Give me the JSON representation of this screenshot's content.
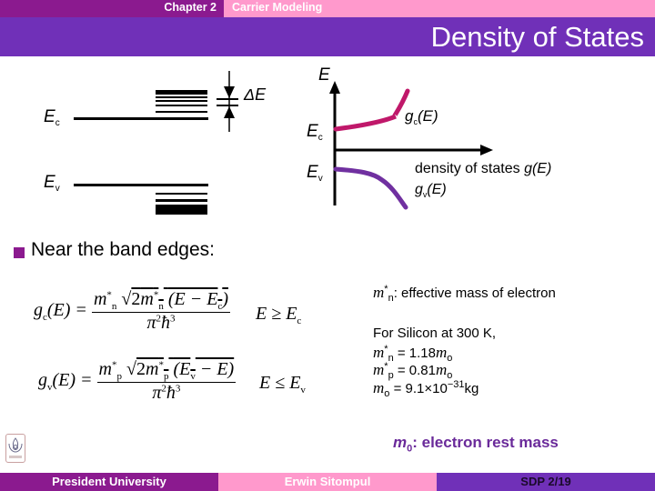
{
  "header": {
    "chapter": "Chapter 2",
    "subject": "Carrier Modeling",
    "title": "Density of States"
  },
  "band_diagram": {
    "ec_label": "E",
    "ec_sub": "c",
    "ev_label": "E",
    "ev_sub": "v",
    "delta_label": "ΔE"
  },
  "dos_plot": {
    "y_axis_label": "E",
    "ec_label": "E",
    "ec_sub": "c",
    "ev_label": "E",
    "ev_sub": "v",
    "x_axis_label": "density of states",
    "x_axis_func": "g(E)",
    "gc_label": "g",
    "gc_sub": "c",
    "gc_arg": "(E)",
    "gv_label": "g",
    "gv_sub": "v",
    "gv_arg": "(E)",
    "colors": {
      "gc": "#c0186a",
      "gv": "#7030a0"
    }
  },
  "bullet": {
    "text": "Near the band edges:"
  },
  "equations": {
    "gc": {
      "lhs": "g",
      "lhs_sub": "c",
      "arg": "(E) =",
      "num_pre": "m",
      "num_sub": "n",
      "sqrt": "2m",
      "sqrt_sub": "n",
      "paren": "(E − E",
      "paren_sub": "c",
      "close": ")",
      "den": "π",
      "den_sup": "2",
      "hbar": "ħ",
      "hbar_sup": "3",
      "cond": "E ≥ E",
      "cond_sub": "c"
    },
    "gv": {
      "lhs": "g",
      "lhs_sub": "v",
      "arg": "(E) =",
      "num_pre": "m",
      "num_sub": "p",
      "sqrt": "2m",
      "sqrt_sub": "p",
      "paren": "(E",
      "paren_sub": "v",
      "close": " − E)",
      "den": "π",
      "den_sup": "2",
      "hbar": "ħ",
      "hbar_sup": "3",
      "cond": "E ≤ E",
      "cond_sub": "v"
    }
  },
  "notes": {
    "mn_def": ":  effective mass of electron",
    "silicon": "For Silicon at 300 K,",
    "mn_value": "= 1.18",
    "mp_value": "= 0.81",
    "m0_value": "= 9.1×10",
    "m0_exp": "−31",
    "m0_unit": "kg",
    "m_sym": "m",
    "star": "*",
    "n_sub": "n",
    "p_sub": "p",
    "o_sub": "o"
  },
  "rest_mass": {
    "sym": "m",
    "sub": "0",
    "text": ": electron rest mass"
  },
  "footer": {
    "university": "President University",
    "author": "Erwin Sitompul",
    "page": "SDP 2/19"
  }
}
